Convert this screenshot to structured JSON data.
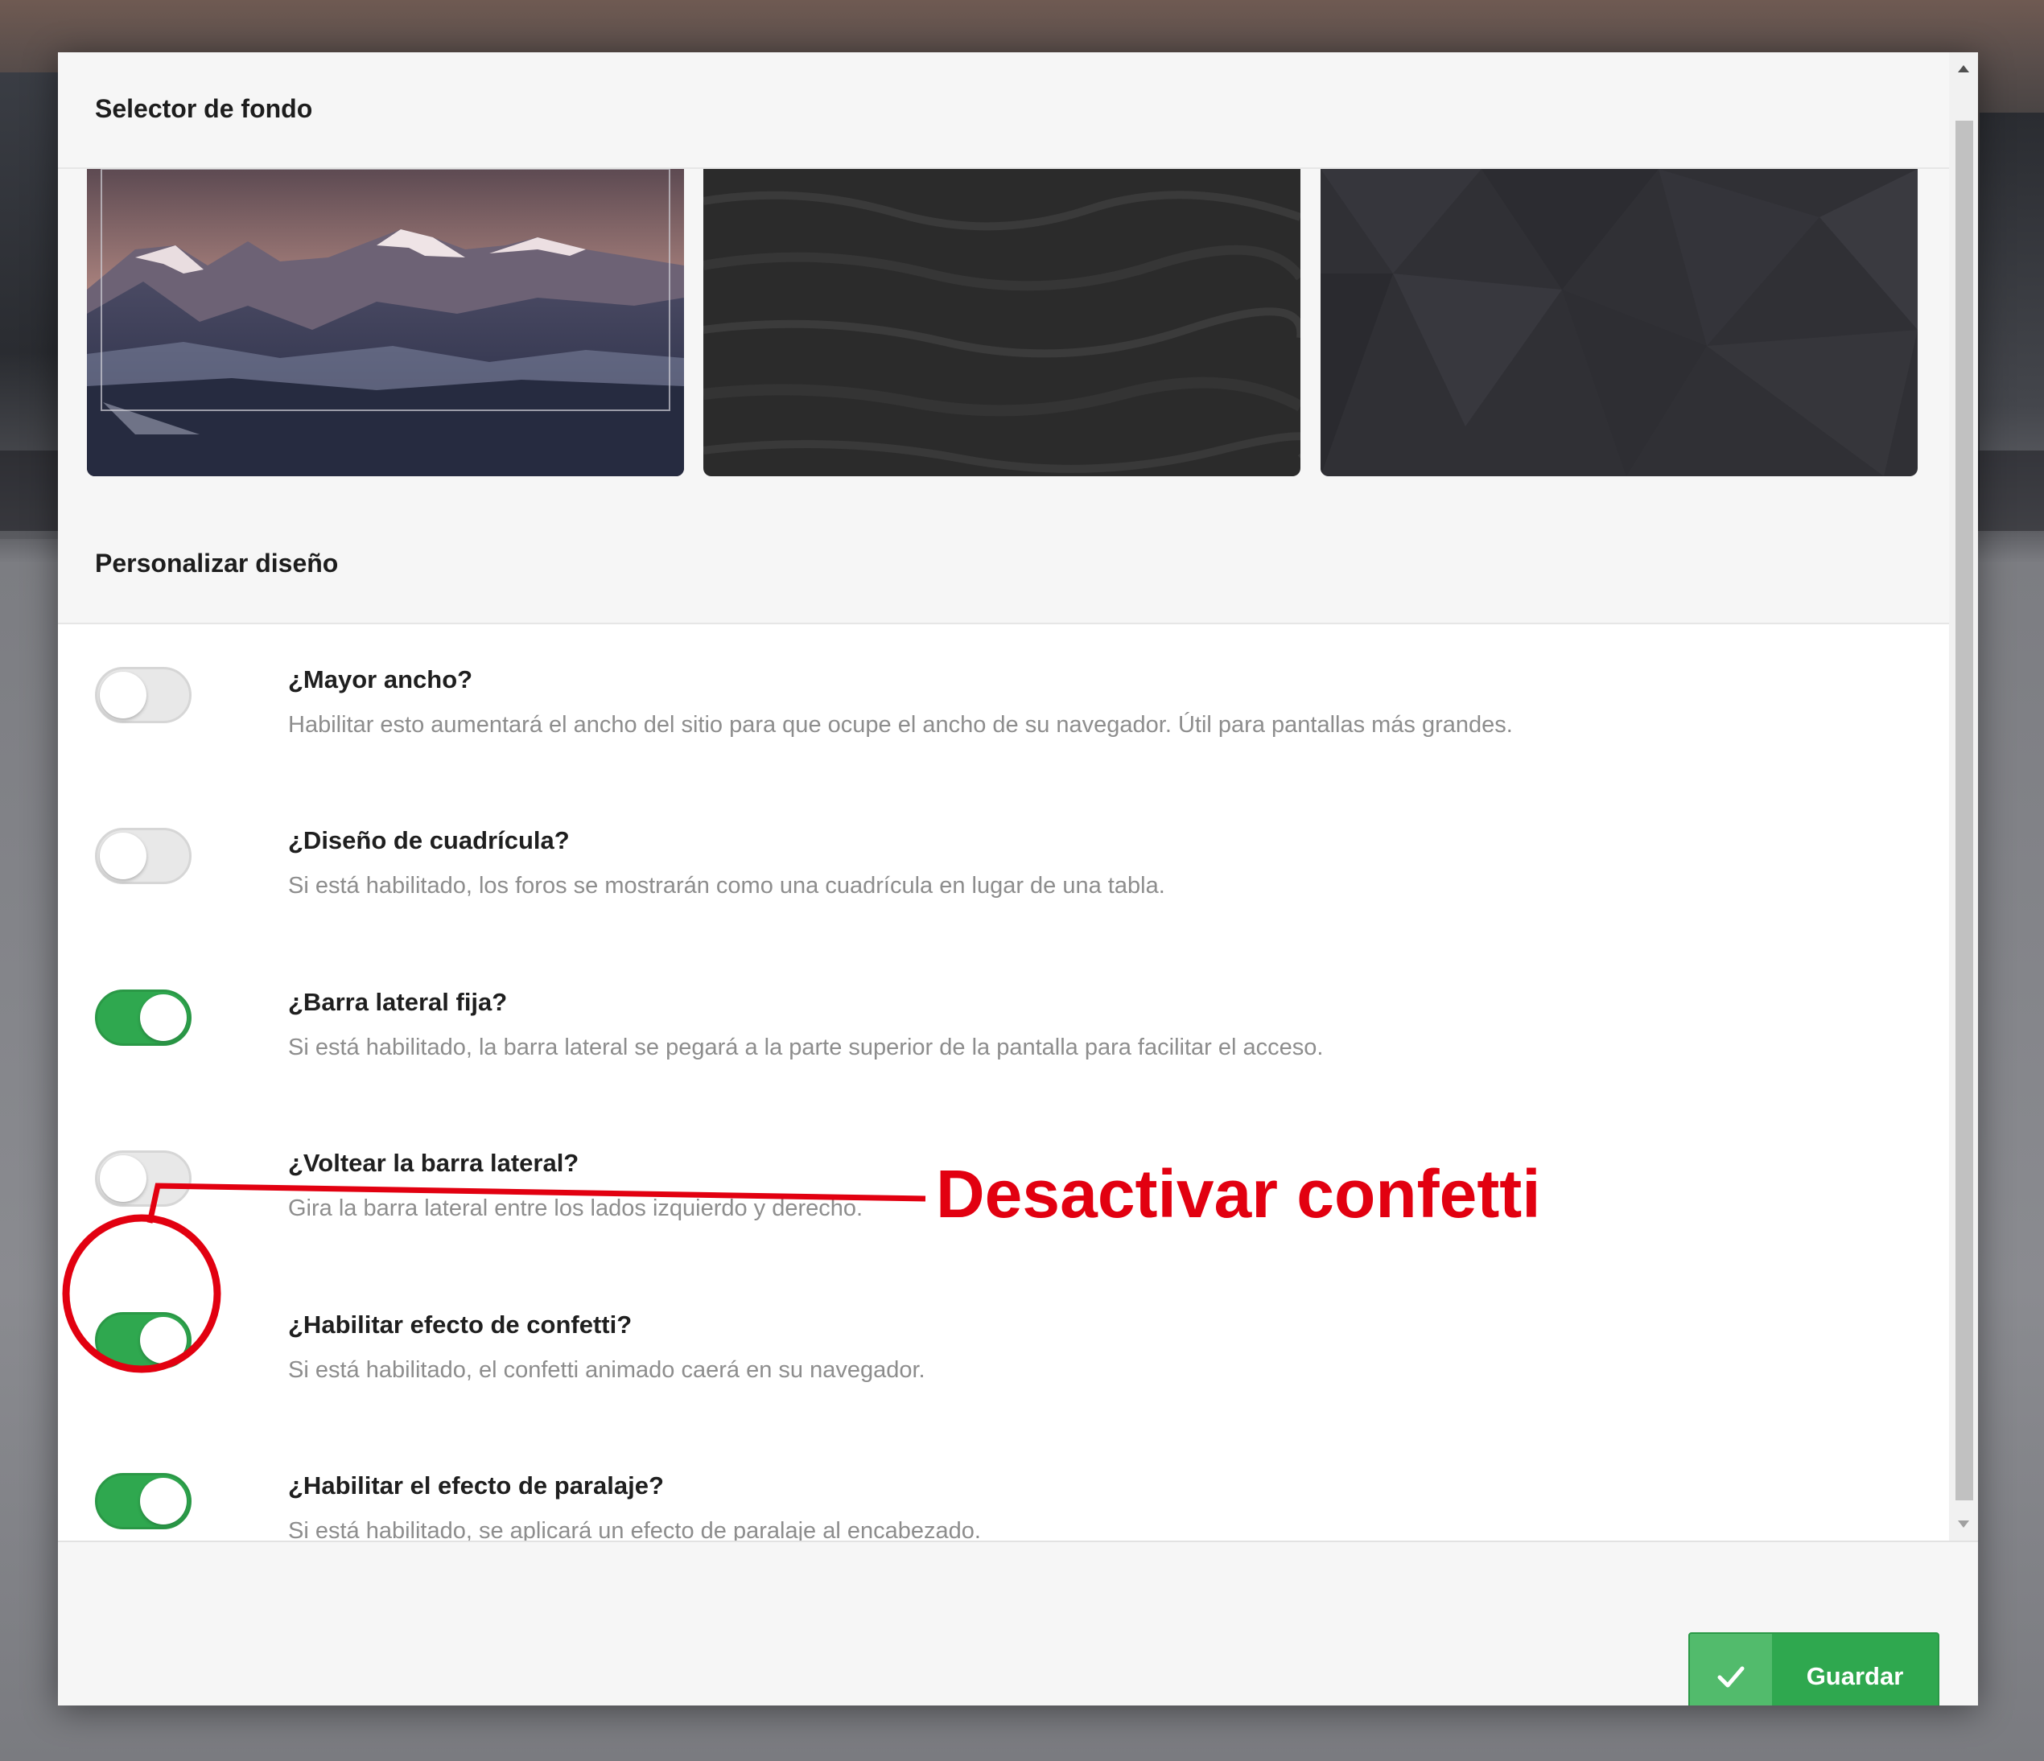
{
  "background_selector": {
    "title": "Selector de fondo",
    "thumbnails": [
      {
        "name": "mountains",
        "selected": true
      },
      {
        "name": "dark-water"
      },
      {
        "name": "dark-polygons"
      }
    ]
  },
  "design": {
    "title": "Personalizar diseño",
    "settings": [
      {
        "label": "¿Mayor ancho?",
        "description": "Habilitar esto aumentará el ancho del sitio para que ocupe el ancho de su navegador. Útil para pantallas más grandes.",
        "enabled": false
      },
      {
        "label": "¿Diseño de cuadrícula?",
        "description": "Si está habilitado, los foros se mostrarán como una cuadrícula en lugar de una tabla.",
        "enabled": false
      },
      {
        "label": "¿Barra lateral fija?",
        "description": "Si está habilitado, la barra lateral se pegará a la parte superior de la pantalla para facilitar el acceso.",
        "enabled": true
      },
      {
        "label": "¿Voltear la barra lateral?",
        "description": "Gira la barra lateral entre los lados izquierdo y derecho.",
        "enabled": false
      },
      {
        "label": "¿Habilitar efecto de confetti?",
        "description": "Si está habilitado, el confetti animado caerá en su navegador.",
        "enabled": true
      },
      {
        "label": "¿Habilitar el efecto de paralaje?",
        "description": "Si está habilitado, se aplicará un efecto de paralaje al encabezado.",
        "enabled": true
      }
    ]
  },
  "footer": {
    "save_label": "Guardar",
    "save_icon": "check-icon"
  },
  "annotation": {
    "text": "Desactivar confetti",
    "color": "#e20010"
  },
  "colors": {
    "toggle_on": "#2fa84f",
    "toggle_off": "#e8e8e8"
  }
}
